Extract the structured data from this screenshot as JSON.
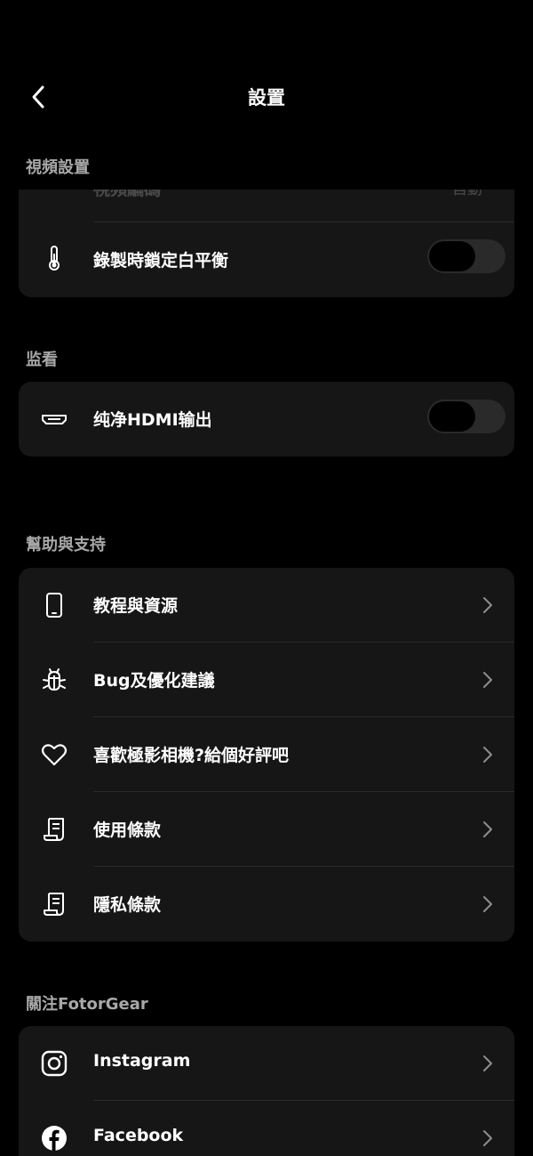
{
  "header": {
    "title": "設置"
  },
  "sections": {
    "video": {
      "title": "視頻設置",
      "partial_row_label": "視頻編碼",
      "partial_row_value": "自動",
      "wb_lock_label": "錄製時鎖定白平衡"
    },
    "monitor": {
      "title": "监看",
      "clean_hdmi_label": "纯净HDMI输出"
    },
    "help": {
      "title": "幫助與支持",
      "items": [
        {
          "label": "教程與資源",
          "icon": "phone-icon"
        },
        {
          "label": "Bug及優化建議",
          "icon": "bug-icon"
        },
        {
          "label": "喜歡極影相機?給個好評吧",
          "icon": "heart-icon"
        },
        {
          "label": "使用條款",
          "icon": "document-icon"
        },
        {
          "label": "隱私條款",
          "icon": "document-icon"
        }
      ]
    },
    "follow": {
      "title": "關注FotorGear",
      "items": [
        {
          "label": "Instagram",
          "icon": "instagram-icon"
        },
        {
          "label": "Facebook",
          "icon": "facebook-icon"
        }
      ]
    }
  },
  "toggles": {
    "wb_lock_on": false,
    "clean_hdmi_on": false
  },
  "colors": {
    "background": "#000000",
    "card": "#161616",
    "section_header": "#a8a8a8",
    "toggle_track": "#2a2a2a"
  }
}
